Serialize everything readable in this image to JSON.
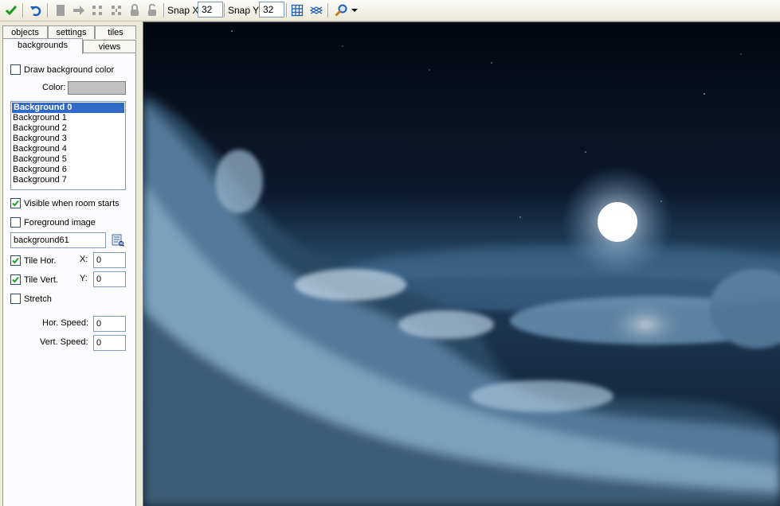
{
  "toolbar": {
    "buttons": [
      {
        "icon": "check-icon",
        "tip": ""
      },
      {
        "icon": "undo-icon",
        "tip": ""
      },
      {
        "icon": "clear-room-icon",
        "tip": ""
      },
      {
        "icon": "shift-right-icon",
        "tip": ""
      },
      {
        "icon": "move-objects-icon",
        "tip": ""
      },
      {
        "icon": "move-vertical-icon",
        "tip": ""
      },
      {
        "icon": "lock-icon",
        "tip": ""
      },
      {
        "icon": "unlock-icon",
        "tip": ""
      }
    ],
    "snap_x_label": "Snap X:",
    "snap_x_value": "32",
    "snap_y_label": "Snap Y:",
    "snap_y_value": "32"
  },
  "tabs": {
    "objects": "objects",
    "settings": "settings",
    "tiles": "tiles",
    "backgrounds": "backgrounds",
    "views": "views"
  },
  "backgrounds_panel": {
    "draw_bg_color_label": "Draw background color",
    "draw_bg_color_checked": false,
    "color_label": "Color:",
    "color_value": "#c0c0c0",
    "list": [
      "Background 0",
      "Background 1",
      "Background 2",
      "Background 3",
      "Background 4",
      "Background 5",
      "Background 6",
      "Background 7"
    ],
    "selected_index": 0,
    "visible_label": "Visible when room starts",
    "visible_checked": true,
    "foreground_label": "Foreground image",
    "foreground_checked": false,
    "background_name": "background61",
    "tile_hor_label": "Tile Hor.",
    "tile_hor_checked": true,
    "tile_vert_label": "Tile Vert.",
    "tile_vert_checked": true,
    "x_label": "X:",
    "x_value": "0",
    "y_label": "Y:",
    "y_value": "0",
    "stretch_label": "Stretch",
    "stretch_checked": false,
    "hor_speed_label": "Hor. Speed:",
    "hor_speed_value": "0",
    "vert_speed_label": "Vert. Speed:",
    "vert_speed_value": "0"
  },
  "colors": {
    "selection": "#316ac5",
    "sky_top": "#050a15",
    "sky_horizon": "#3d6a8c"
  }
}
